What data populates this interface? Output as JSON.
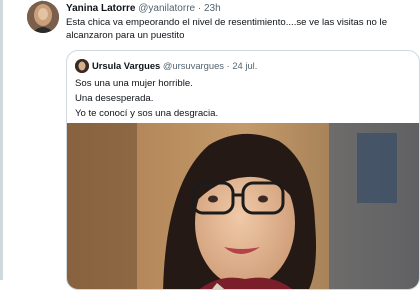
{
  "tweet": {
    "display_name": "Yanina Latorre",
    "handle": "@yanilatorre",
    "separator": "·",
    "timestamp": "23h",
    "text": "Esta chica va empeorando el nivel de resentimiento....se ve las visitas no le alcanzaron para un puestito"
  },
  "quoted_tweet": {
    "display_name": "Ursula Vargues",
    "handle": "@ursuvargues",
    "separator": "·",
    "timestamp": "24 jul.",
    "lines": [
      "Sos una una mujer horrible.",
      "Una desesperada.",
      "Yo te conocí y sos una desgracia."
    ]
  },
  "colors": {
    "text": "#0f1419",
    "muted": "#536471",
    "border": "#cfd9de"
  }
}
